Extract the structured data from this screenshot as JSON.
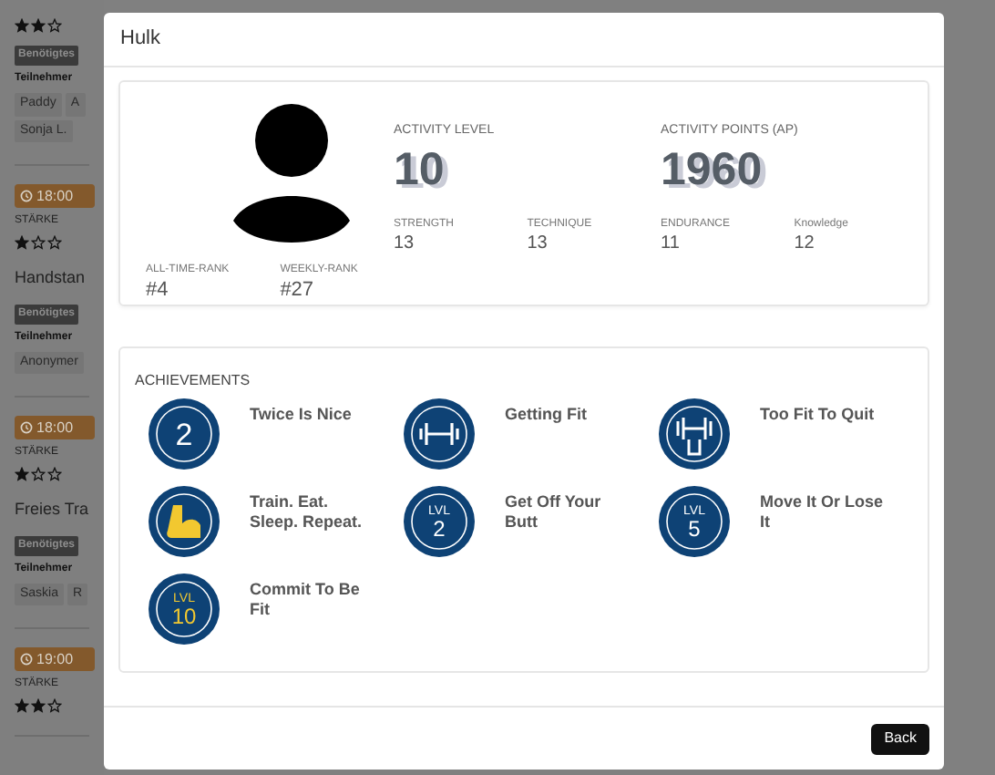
{
  "background": {
    "sessions": [
      {
        "stars": 2,
        "requirement": "Benötigtes",
        "participants_label": "Teilnehmer",
        "participants": [
          "Paddy",
          "A",
          "Sonja L."
        ]
      },
      {
        "time": "18:00",
        "category": "STÄRKE",
        "stars": 1,
        "title": "Handstan",
        "requirement": "Benötigtes",
        "participants_label": "Teilnehmer",
        "participants": [
          "Anonymer"
        ]
      },
      {
        "time": "18:00",
        "category": "STÄRKE",
        "stars": 1,
        "title": "Freies Tra",
        "requirement": "Benötigtes",
        "participants_label": "Teilnehmer",
        "participants": [
          "Saskia",
          "R"
        ]
      },
      {
        "time": "19:00",
        "category": "STÄRKE",
        "stars": 2
      }
    ]
  },
  "modal": {
    "title": "Hulk",
    "ranks": [
      {
        "label": "ALL-TIME-RANK",
        "value": "#4"
      },
      {
        "label": "WEEKLY-RANK",
        "value": "#27"
      }
    ],
    "headline_stats": [
      {
        "label": "ACTIVITY LEVEL",
        "value": "10"
      },
      {
        "label": "ACTIVITY POINTS (AP)",
        "value": "1960"
      }
    ],
    "stats": [
      {
        "label": "STRENGTH",
        "value": "13"
      },
      {
        "label": "TECHNIQUE",
        "value": "13"
      },
      {
        "label": "ENDURANCE",
        "value": "11"
      },
      {
        "label": "Knowledge",
        "value": "12"
      }
    ],
    "achievements_title": "ACHIEVEMENTS",
    "achievements": [
      {
        "name": "Twice Is Nice",
        "kind": "number",
        "badge_lines": [
          "2"
        ]
      },
      {
        "name": "Getting Fit",
        "kind": "dumbbell"
      },
      {
        "name": "Too Fit To Quit",
        "kind": "dumbbell-stand"
      },
      {
        "name": "Train. Eat. Sleep. Repeat.",
        "kind": "arm"
      },
      {
        "name": "Get Off Your Butt",
        "kind": "level",
        "badge_lines": [
          "LVL",
          "2"
        ],
        "gold": false
      },
      {
        "name": "Move It Or Lose It",
        "kind": "level",
        "badge_lines": [
          "LVL",
          "5"
        ],
        "gold": false
      },
      {
        "name": "Commit To Be Fit",
        "kind": "level",
        "badge_lines": [
          "LVL",
          "10"
        ],
        "gold": true
      }
    ],
    "buttons": [
      {
        "label": "Back"
      }
    ]
  }
}
